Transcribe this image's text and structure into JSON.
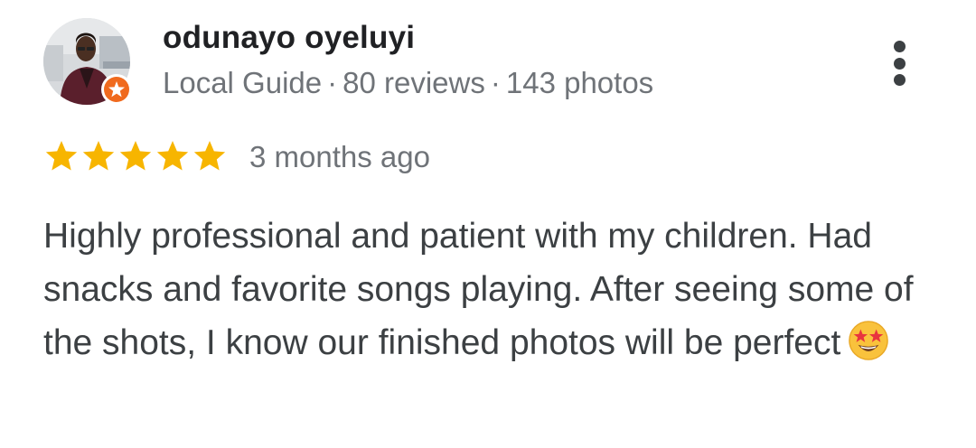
{
  "reviewer": {
    "name": "odunayo oyeluyi",
    "guide_label": "Local Guide",
    "separator": "·",
    "reviews": "80 reviews",
    "photos": "143 photos"
  },
  "review": {
    "rating": 5,
    "rating_max": 5,
    "time": "3 months ago",
    "text": "Highly professional and patient with my children. Had snacks and favorite songs playing. After seeing some of the shots, I know our finished photos will be perfect",
    "emoji": "star-struck-emoji"
  },
  "icons": {
    "menu": "more-vertical-icon",
    "badge": "local-guide-badge-icon",
    "star": "star-icon"
  },
  "colors": {
    "star": "#f7b500",
    "badge": "#f06a1e",
    "name": "#202124",
    "meta": "#6f7378",
    "text": "#3c4043"
  }
}
